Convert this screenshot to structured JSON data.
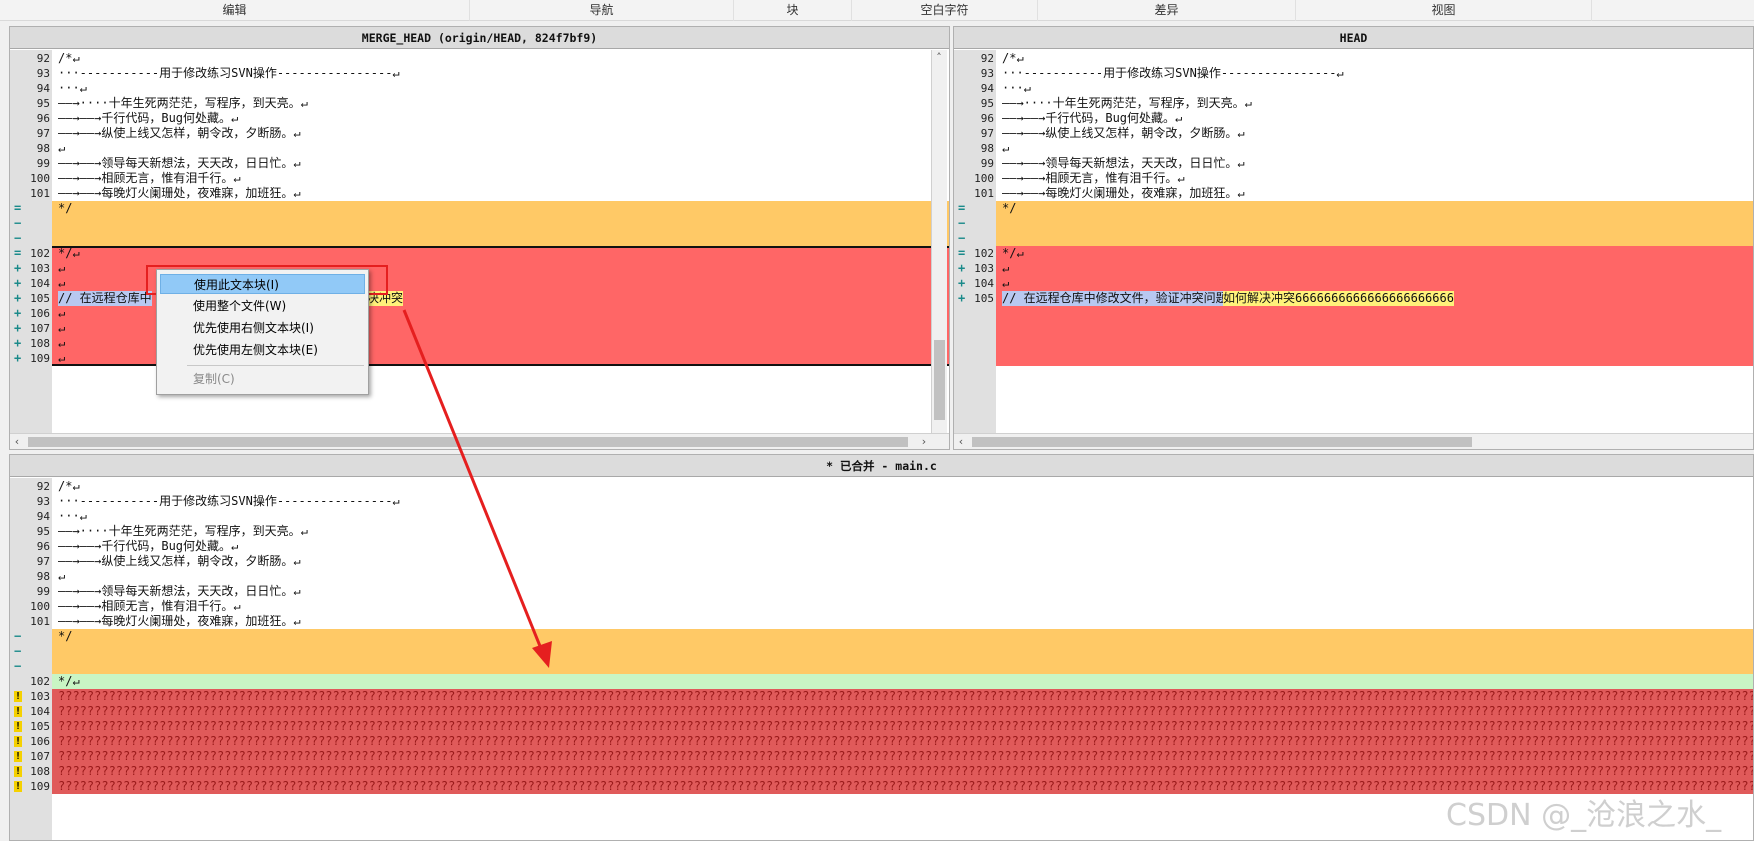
{
  "menubar": {
    "items": [
      "编辑",
      "导航",
      "块",
      "空白字符",
      "差异",
      "视图"
    ]
  },
  "left_pane": {
    "title": "MERGE_HEAD (origin/HEAD, 824f7bf9)",
    "lines": [
      {
        "num": "92",
        "text": "/*↵"
      },
      {
        "num": "93",
        "text": "···-----------用于修改练习SVN操作----------------↵"
      },
      {
        "num": "94",
        "text": "···↵"
      },
      {
        "num": "95",
        "text": "——→····十年生死两茫茫，写程序，到天亮。↵"
      },
      {
        "num": "96",
        "text": "——→——→千行代码，Bug何处藏。↵"
      },
      {
        "num": "97",
        "text": "——→——→纵使上线又怎样，朝令改，夕断肠。↵"
      },
      {
        "num": "98",
        "text": "↵"
      },
      {
        "num": "99",
        "text": "——→——→领导每天新想法，天天改，日日忙。↵"
      },
      {
        "num": "100",
        "text": "——→——→相顾无言，惟有泪千行。↵"
      },
      {
        "num": "101",
        "text": "——→——→每晚灯火阑珊处，夜难寐，加班狂。↵"
      },
      {
        "num": "",
        "text": "*/"
      },
      {
        "num": "102",
        "text": "*/↵"
      },
      {
        "num": "103",
        "text": "↵"
      },
      {
        "num": "104",
        "text": "↵"
      },
      {
        "num": "105",
        "text": "// 在远程仓库中"
      },
      {
        "num": "106",
        "text": "↵"
      },
      {
        "num": "107",
        "text": "↵"
      },
      {
        "num": "108",
        "text": "↵"
      },
      {
        "num": "109",
        "text": "↵"
      }
    ],
    "line105_tail": "决冲突"
  },
  "right_pane": {
    "title": "HEAD",
    "lines": [
      {
        "num": "92",
        "text": "/*↵"
      },
      {
        "num": "93",
        "text": "···-----------用于修改练习SVN操作----------------↵"
      },
      {
        "num": "94",
        "text": "···↵"
      },
      {
        "num": "95",
        "text": "——→····十年生死两茫茫，写程序，到天亮。↵"
      },
      {
        "num": "96",
        "text": "——→——→千行代码，Bug何处藏。↵"
      },
      {
        "num": "97",
        "text": "——→——→纵使上线又怎样，朝令改，夕断肠。↵"
      },
      {
        "num": "98",
        "text": "↵"
      },
      {
        "num": "99",
        "text": "——→——→领导每天新想法，天天改，日日忙。↵"
      },
      {
        "num": "100",
        "text": "——→——→相顾无言，惟有泪千行。↵"
      },
      {
        "num": "101",
        "text": "——→——→每晚灯火阑珊处，夜难寐，加班狂。↵"
      },
      {
        "num": "",
        "text": "*/"
      },
      {
        "num": "102",
        "text": "*/↵"
      },
      {
        "num": "103",
        "text": "↵"
      },
      {
        "num": "104",
        "text": "↵"
      },
      {
        "num": "105",
        "text": "// 在远程仓库中修改文件，验证冲突问题，"
      }
    ],
    "line105_tail": "如何解决冲突6666666666666666666666"
  },
  "merged_pane": {
    "title": "* 已合并 - main.c",
    "lines": [
      {
        "num": "92",
        "text": "/*↵"
      },
      {
        "num": "93",
        "text": "···-----------用于修改练习SVN操作----------------↵"
      },
      {
        "num": "94",
        "text": "···↵"
      },
      {
        "num": "95",
        "text": "——→····十年生死两茫茫，写程序，到天亮。↵"
      },
      {
        "num": "96",
        "text": "——→——→千行代码，Bug何处藏。↵"
      },
      {
        "num": "97",
        "text": "——→——→纵使上线又怎样，朝令改，夕断肠。↵"
      },
      {
        "num": "98",
        "text": "↵"
      },
      {
        "num": "99",
        "text": "——→——→领导每天新想法，天天改，日日忙。↵"
      },
      {
        "num": "100",
        "text": "——→——→相顾无言，惟有泪千行。↵"
      },
      {
        "num": "101",
        "text": "——→——→每晚灯火阑珊处，夜难寐，加班狂。↵"
      },
      {
        "num": "",
        "text": "*/"
      },
      {
        "num": "102",
        "text": "*/↵"
      }
    ],
    "conflict_nums": [
      "103",
      "104",
      "105",
      "106",
      "107",
      "108",
      "109"
    ],
    "conflict_fill": "???????????????????????????????????????????????????????????????????????????????????????????????????????????????????????????????????????????????????????????????????????????????????????????????????????????????????????????????????????????????????????????????????????????????????????"
  },
  "context_menu": {
    "items": [
      {
        "label": "使用此文本块(I)",
        "active": true
      },
      {
        "label": "使用整个文件(W)"
      },
      {
        "label": "优先使用右侧文本块(I)"
      },
      {
        "label": "优先使用左侧文本块(E)"
      },
      {
        "label": "复制(C)",
        "disabled": true
      }
    ]
  },
  "watermark": "CSDN @_沧浪之水_",
  "colors": {
    "yellow_band": "#ffc966",
    "red_band": "#ff6666",
    "green_band": "#c9f5c4",
    "conflict_band": "#e05a5a",
    "annotation_red": "#e51f1f"
  },
  "icons": {
    "equal_marker": "equal-icon",
    "plus_marker": "plus-icon",
    "minus_marker": "minus-icon",
    "conflict_marker": "warning-icon"
  }
}
